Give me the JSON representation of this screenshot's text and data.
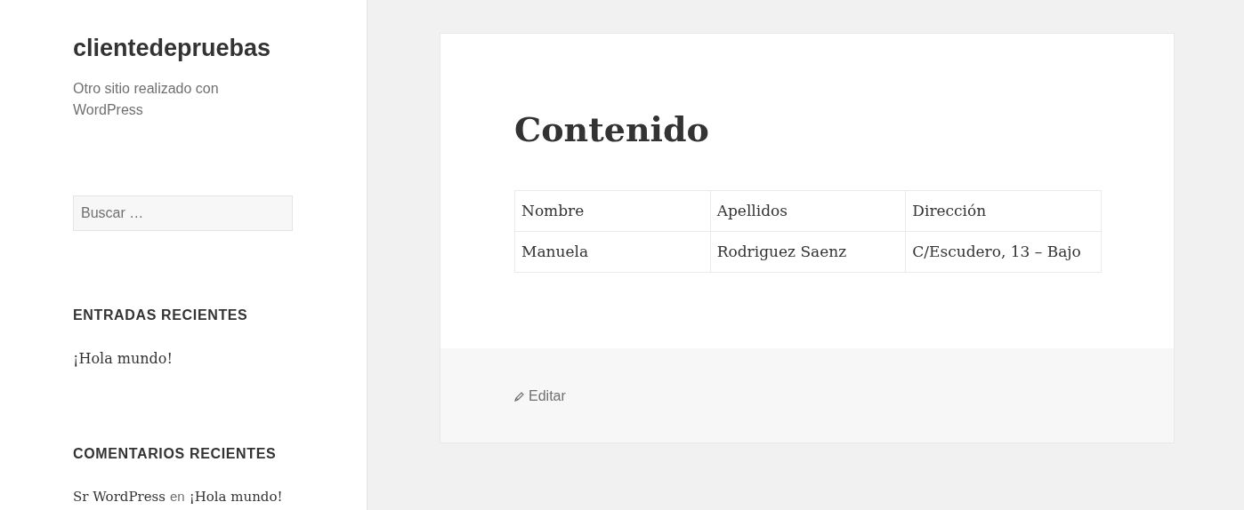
{
  "site": {
    "title": "clientedepruebas",
    "description": "Otro sitio realizado con WordPress"
  },
  "search": {
    "placeholder": "Buscar …"
  },
  "widgets": [
    {
      "heading": "ENTRADAS RECIENTES",
      "items": [
        {
          "kind": "post",
          "link": "¡Hola mundo!"
        }
      ]
    },
    {
      "heading": "COMENTARIOS RECIENTES",
      "items": [
        {
          "kind": "comment",
          "author": "Sr WordPress",
          "connector": "en",
          "post": "¡Hola mundo!"
        }
      ]
    }
  ],
  "entry": {
    "title": "Contenido",
    "table": {
      "rows": [
        [
          "Nombre",
          "Apellidos",
          "Dirección"
        ],
        [
          "Manuela",
          "Rodriguez Saenz",
          "C/Escudero, 13 – Bajo"
        ]
      ]
    },
    "edit_link": "Editar"
  }
}
